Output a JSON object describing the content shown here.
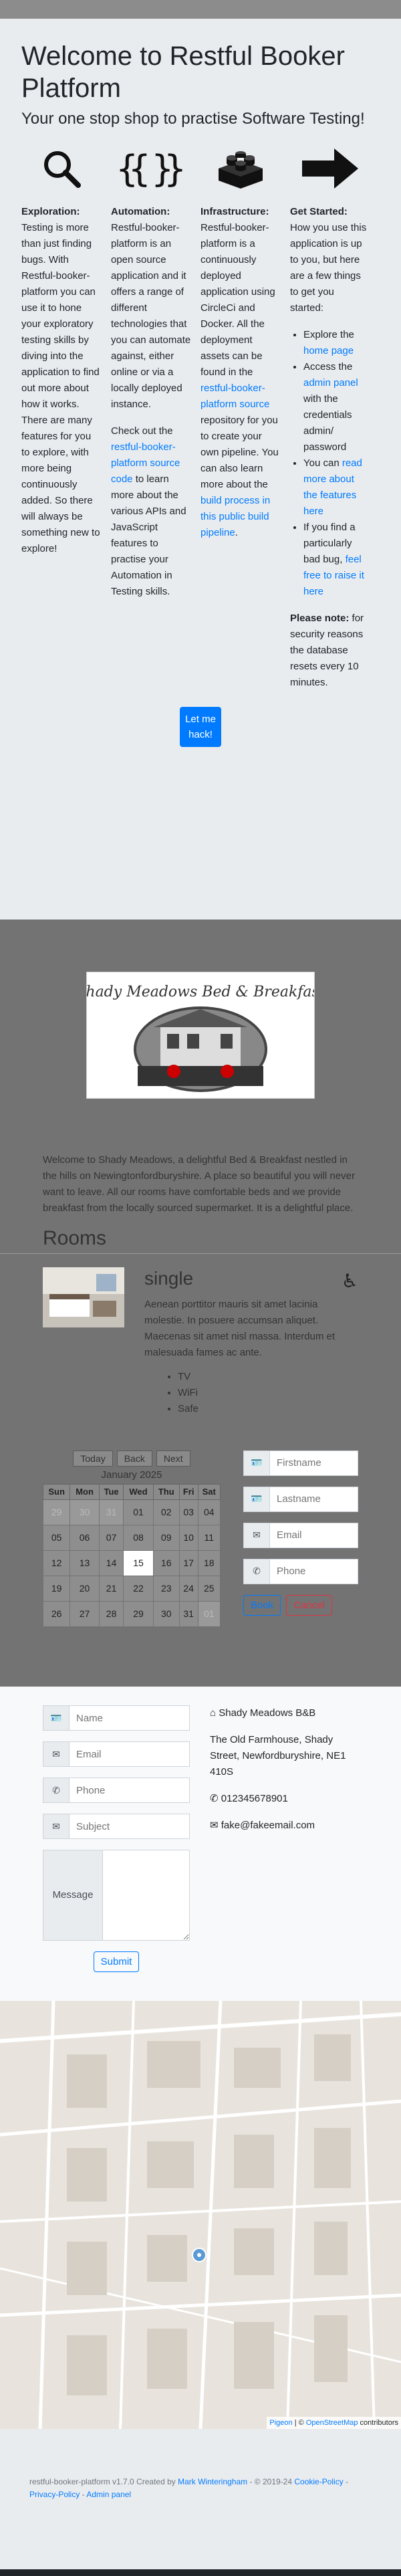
{
  "modal": {
    "title": "Welcome to Restful Booker Platform",
    "lead": "Your one stop shop to practise Software Testing!",
    "columns": [
      {
        "icon": "search-icon",
        "heading": "Exploration:",
        "text": "Testing is more than just finding bugs. With Restful-booker-platform you can use it to hone your exploratory testing skills by diving into the application to find out more about how it works. There are many features for you to explore, with more being continuously added. So there will always be something new to explore!"
      },
      {
        "icon": "code-braces-icon",
        "heading": "Automation:",
        "text": "Restful-booker-platform is an open source application and it offers a range of different technologies that you can automate against, either online or via a locally deployed instance.",
        "text2_pre": "Check out the ",
        "link": "restful-booker-platform source code",
        "text2_post": " to learn more about the various APIs and JavaScript features to practise your Automation in Testing skills."
      },
      {
        "icon": "lego-brick-icon",
        "heading": "Infrastructure:",
        "text_pre": "Restful-booker-platform is a continuously deployed application using CircleCi and Docker. All the deployment assets can be found in the ",
        "link1": "restful-booker-platform source",
        "text_mid": " repository for you to create your own pipeline. You can also learn more about the ",
        "link2": "build process in this public build pipeline",
        "text_post": "."
      },
      {
        "icon": "arrow-right-icon",
        "heading": "Get Started:",
        "text": "How you use this application is up to you, but here are a few things to get you started:",
        "bullets": [
          {
            "pre": "Explore the ",
            "link": "home page",
            "post": ""
          },
          {
            "pre": "Access the ",
            "link": "admin panel",
            "post": " with the credentials admin/ password"
          },
          {
            "pre": "You can ",
            "link": "read more about the features here",
            "post": ""
          },
          {
            "pre": "If you find a particularly bad bug, ",
            "link": "feel free to raise it here",
            "post": ""
          }
        ],
        "note_heading": "Please note:",
        "note": "for security reasons the database resets every 10 minutes."
      }
    ],
    "button": "Let me hack!"
  },
  "hotel": {
    "logo_text": "Shady Meadows Bed & Breakfast",
    "welcome": "Welcome to Shady Meadows, a delightful Bed & Breakfast nestled in the hills on Newingtonfordburyshire. A place so beautiful you will never want to leave. All our rooms have comfortable beds and we provide breakfast from the locally sourced supermarket. It is a delightful place.",
    "rooms_heading": "Rooms",
    "room": {
      "type": "single",
      "description": "Aenean porttitor mauris sit amet lacinia molestie. In posuere accumsan aliquet. Maecenas sit amet nisl massa. Interdum et malesuada fames ac ante.",
      "features": [
        "TV",
        "WiFi",
        "Safe"
      ]
    }
  },
  "calendar": {
    "nav": [
      "Today",
      "Back",
      "Next"
    ],
    "month": "January 2025",
    "days": [
      "Sun",
      "Mon",
      "Tue",
      "Wed",
      "Thu",
      "Fri",
      "Sat"
    ],
    "weeks": [
      [
        "29",
        "30",
        "31",
        "01",
        "02",
        "03",
        "04"
      ],
      [
        "05",
        "06",
        "07",
        "08",
        "09",
        "10",
        "11"
      ],
      [
        "12",
        "13",
        "14",
        "15",
        "16",
        "17",
        "18"
      ],
      [
        "19",
        "20",
        "21",
        "22",
        "23",
        "24",
        "25"
      ],
      [
        "26",
        "27",
        "28",
        "29",
        "30",
        "31",
        "01"
      ]
    ]
  },
  "booking": {
    "firstname": "Firstname",
    "lastname": "Lastname",
    "email": "Email",
    "phone": "Phone",
    "book": "Book",
    "cancel": "Cancel"
  },
  "contact": {
    "name": "Name",
    "email": "Email",
    "phone": "Phone",
    "subject": "Subject",
    "message": "Message",
    "submit": "Submit",
    "business": "Shady Meadows B&B",
    "address": "The Old Farmhouse, Shady Street, Newfordburyshire, NE1 410S",
    "phone_number": "012345678901",
    "email_address": "fake@fakeemail.com"
  },
  "map": {
    "attribution_pre": "Pigeon",
    "attribution_sep": " | © ",
    "attribution_link": "OpenStreetMap",
    "attribution_post": " contributors"
  },
  "footer": {
    "pre": "restful-booker-platform v1.7.0 Created by ",
    "author": "Mark Winteringham",
    "mid": " - © 2019-24 ",
    "cookie": "Cookie-Policy",
    "sep": " - ",
    "privacy": "Privacy-Policy",
    "sep2": " - ",
    "admin": "Admin panel"
  }
}
